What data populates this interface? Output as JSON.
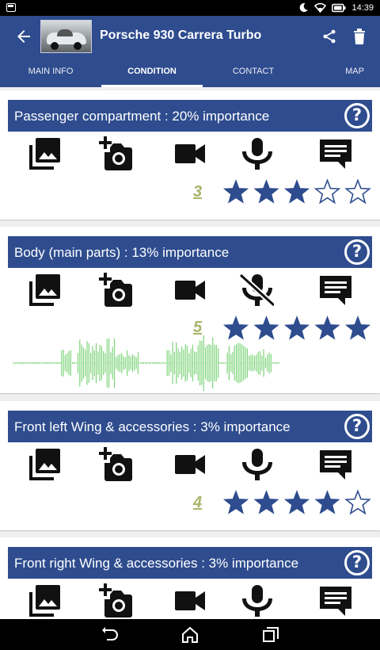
{
  "status_bar": {
    "time": "14:39",
    "icons": [
      "moon-icon",
      "wifi-icon",
      "battery-icon"
    ]
  },
  "app_bar": {
    "title": "Porsche 930 Carrera Turbo",
    "icons": [
      "back-arrow-icon",
      "share-icon",
      "trash-icon"
    ]
  },
  "tabs": [
    "MAIN INFO",
    "CONDITION",
    "CONTACT",
    "MAP"
  ],
  "active_tab": "CONDITION",
  "colors": {
    "primary": "#2e4c8e",
    "star": "#2e4c8e",
    "rating_number": "#a8b56b",
    "waveform": "#7ed47a"
  },
  "sections": [
    {
      "title": "Passenger compartment : 20% importance",
      "rating": "3",
      "stars_filled": 3,
      "stars_total": 5,
      "mic_state": "enabled"
    },
    {
      "title": "Body (main parts) : 13% importance",
      "rating": "5",
      "stars_filled": 5,
      "stars_total": 5,
      "mic_state": "muted",
      "has_audio_waveform": true
    },
    {
      "title": "Front left Wing & accessories : 3% importance",
      "rating": "4",
      "stars_filled": 4,
      "stars_total": 5,
      "mic_state": "enabled"
    },
    {
      "title": "Front right Wing & accessories : 3% importance",
      "mic_state": "enabled"
    }
  ],
  "section_tools": [
    "gallery-icon",
    "add-photo-icon",
    "video-camera-icon",
    "microphone-icon",
    "comment-icon"
  ],
  "help_symbol": "?",
  "nav_bar": [
    "back-nav-icon",
    "home-nav-icon",
    "recents-nav-icon"
  ]
}
